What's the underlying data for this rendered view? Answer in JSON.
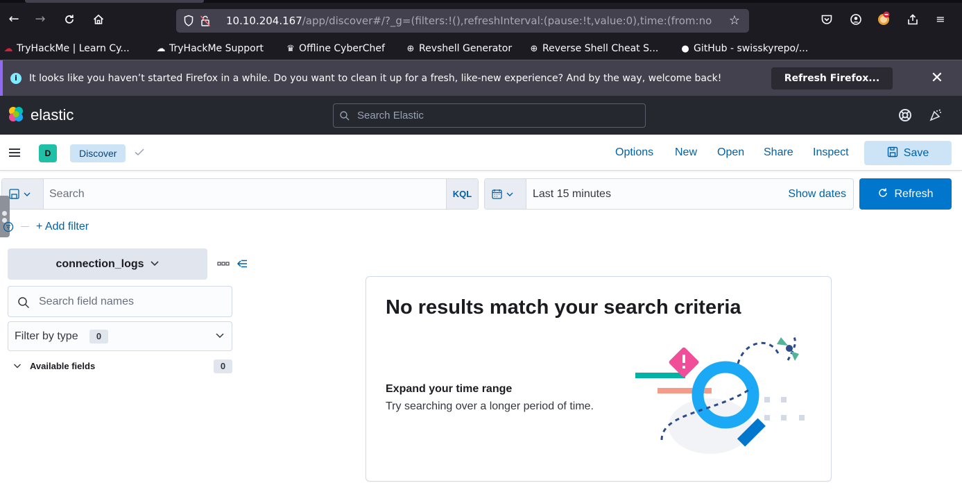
{
  "browser": {
    "url_host": "10.10.204.167",
    "url_path": "/app/discover#/?_g=(filters:!(),refreshInterval:(pause:!t,value:0),time:(from:no",
    "bookmarks": [
      {
        "label": "TryHackMe | Learn Cy...",
        "icon": "tryhackme-icon"
      },
      {
        "label": "TryHackMe Support",
        "icon": "support-icon"
      },
      {
        "label": "Offline CyberChef",
        "icon": "chef-hat-icon"
      },
      {
        "label": "Revshell Generator",
        "icon": "globe-icon"
      },
      {
        "label": "Reverse Shell Cheat S...",
        "icon": "globe-icon"
      },
      {
        "label": "GitHub - swisskyrepo/...",
        "icon": "github-icon"
      }
    ],
    "notice": {
      "message": "It looks like you haven’t started Firefox in a while. Do you want to clean it up for a fresh, like-new experience? And by the way, welcome back!",
      "button": "Refresh Firefox..."
    }
  },
  "header": {
    "brand": "elastic",
    "search_placeholder": "Search Elastic"
  },
  "appbar": {
    "space_initial": "D",
    "breadcrumb": "Discover",
    "links": [
      "Options",
      "New",
      "Open",
      "Share",
      "Inspect"
    ],
    "save_label": "Save"
  },
  "query": {
    "search_placeholder": "Search",
    "language": "KQL",
    "time_range": "Last 15 minutes",
    "show_dates": "Show dates",
    "refresh_label": "Refresh",
    "add_filter": "+ Add filter"
  },
  "sidebar": {
    "index_pattern": "connection_logs",
    "field_search_placeholder": "Search field names",
    "filter_by_type_label": "Filter by type",
    "filter_by_type_count": "0",
    "available_fields_label": "Available fields",
    "available_fields_count": "0"
  },
  "empty_state": {
    "title": "No results match your search criteria",
    "subtitle": "Expand your time range",
    "description": "Try searching over a longer period of time."
  },
  "colors": {
    "primary": "#0077cc",
    "link": "#0061a6",
    "space_avatar": "#20bfa8",
    "header_bg": "#25282f"
  }
}
